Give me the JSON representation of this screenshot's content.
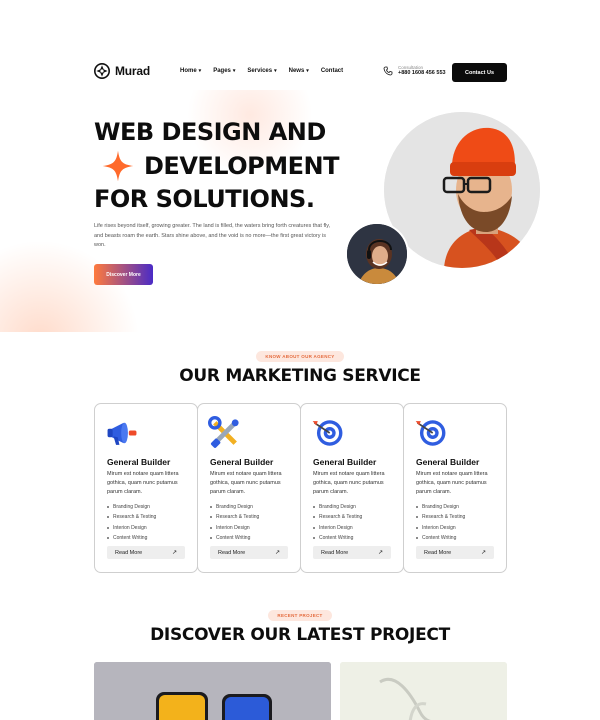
{
  "brand": {
    "name": "Murad"
  },
  "nav": {
    "items": [
      {
        "label": "Home",
        "has_dropdown": true
      },
      {
        "label": "Pages",
        "has_dropdown": true
      },
      {
        "label": "Services",
        "has_dropdown": true
      },
      {
        "label": "News",
        "has_dropdown": true
      },
      {
        "label": "Contact",
        "has_dropdown": false
      }
    ]
  },
  "consultation": {
    "label": "Consultation",
    "phone": "+880 1608 456 553",
    "icon": "phone-icon"
  },
  "header_cta": {
    "label": "Contact Us"
  },
  "hero": {
    "title_line1": "WEB DESIGN AND",
    "title_line2": "DEVELOPMENT",
    "title_line3": "FOR SOLUTIONS.",
    "description": "Life rises beyond itself, growing greater. The land is filled, the waters bring forth creatures that fly, and beasts roam the earth. Stars shine above, and the void is no more—the first great victory is won.",
    "button_label": "Discover More",
    "accent_color": "#ff6a2b"
  },
  "services": {
    "eyebrow": "KNOW ABOUT OUR AGENCY",
    "title": "OUR MARKETING SERVICE",
    "cards": [
      {
        "icon": "megaphone-icon",
        "title": "General Builder",
        "description": "Mirum est notare quam littera gothica, quam nunc putamus parum claram.",
        "items": [
          "Branding Design",
          "Research & Testing",
          "Interion Design",
          "Content Writing"
        ],
        "button_label": "Read More"
      },
      {
        "icon": "tools-icon",
        "title": "General Builder",
        "description": "Mirum est notare quam littera gothica, quam nunc putamus parum claram.",
        "items": [
          "Branding Design",
          "Research & Testing",
          "Interion Design",
          "Content Writing"
        ],
        "button_label": "Read More"
      },
      {
        "icon": "target-icon",
        "title": "General Builder",
        "description": "Mirum est notare quam littera gothica, quam nunc putamus parum claram.",
        "items": [
          "Branding Design",
          "Research & Testing",
          "Interion Design",
          "Content Writing"
        ],
        "button_label": "Read More"
      },
      {
        "icon": "target-icon",
        "title": "General Builder",
        "description": "Mirum est notare quam littera gothica, quam nunc putamus parum claram.",
        "items": [
          "Branding Design",
          "Research & Testing",
          "Interion Design",
          "Content Writing"
        ],
        "button_label": "Read More"
      }
    ]
  },
  "projects": {
    "eyebrow": "RECENT PROJECT",
    "title": "DISCOVER OUR LATEST PROJECT"
  },
  "colors": {
    "pill_bg": "#fde7de",
    "pill_text": "#e46a3c",
    "button_dark": "#0b0b0b",
    "gradient_start": "#ff7a3d",
    "gradient_end": "#4a2bc6"
  }
}
